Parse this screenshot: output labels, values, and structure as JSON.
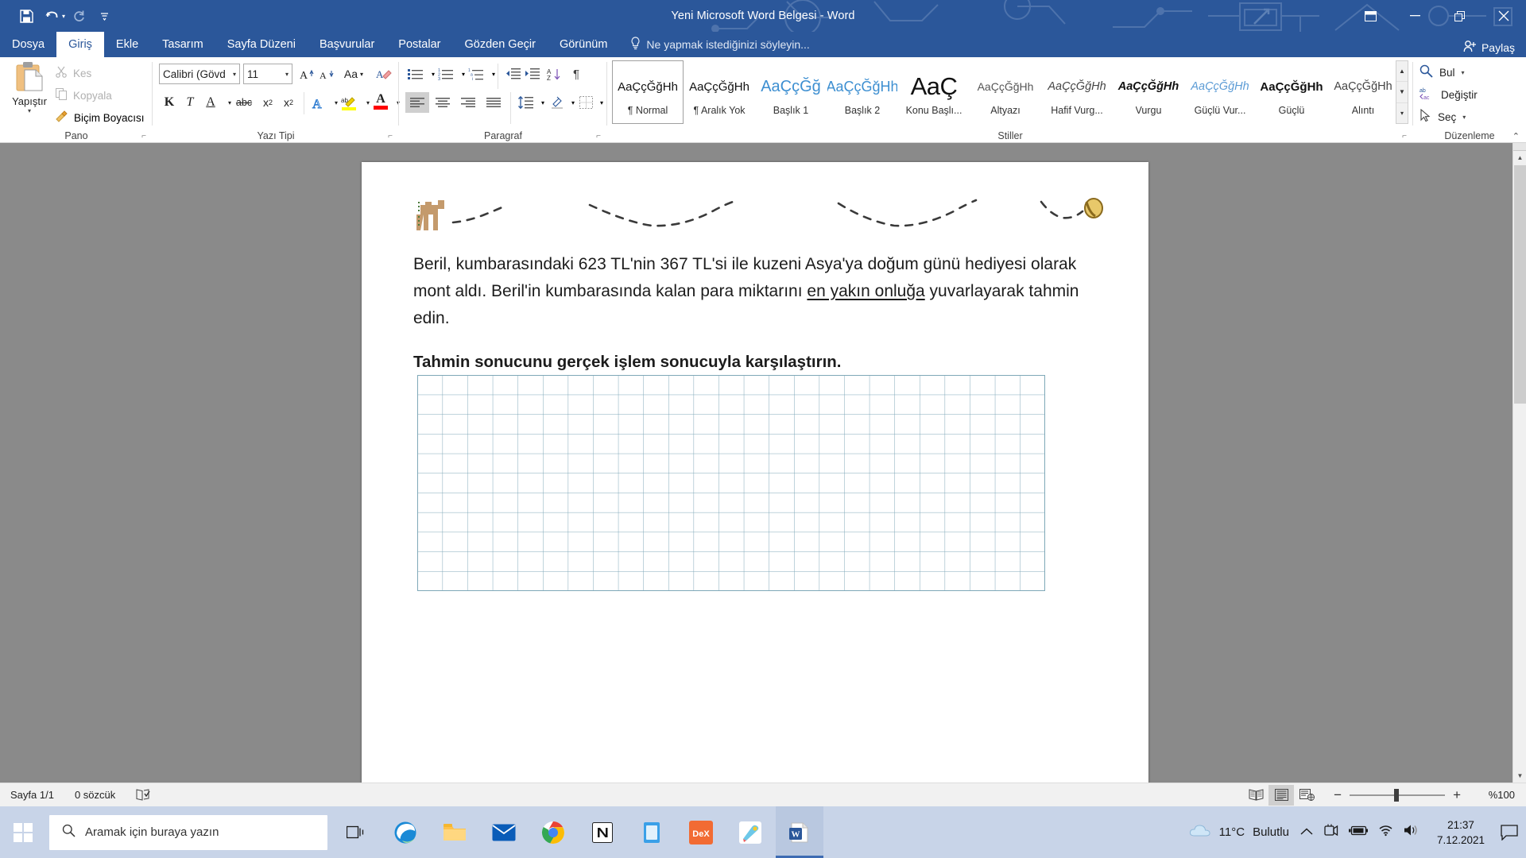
{
  "titlebar": {
    "title": "Yeni Microsoft Word Belgesi - Word",
    "qat": [
      {
        "name": "save-icon",
        "label": "Kaydet"
      },
      {
        "name": "undo-icon",
        "label": "Geri Al"
      },
      {
        "name": "redo-icon",
        "label": "Yinele"
      },
      {
        "name": "customize-qat-icon",
        "label": "Hızlı Erişim Araç Çubuğunu Özelleştir"
      }
    ],
    "window_controls": [
      {
        "name": "ribbon-display-options-icon",
        "label": "Şerit Görüntüleme Seçenekleri"
      },
      {
        "name": "minimize-icon",
        "label": "Simge Durumuna Küçült"
      },
      {
        "name": "restore-icon",
        "label": "Geri Yükle"
      },
      {
        "name": "close-icon",
        "label": "Kapat"
      }
    ],
    "accent": "#2b579a"
  },
  "tabs": [
    {
      "label": "Dosya",
      "active": false
    },
    {
      "label": "Giriş",
      "active": true
    },
    {
      "label": "Ekle",
      "active": false
    },
    {
      "label": "Tasarım",
      "active": false
    },
    {
      "label": "Sayfa Düzeni",
      "active": false
    },
    {
      "label": "Başvurular",
      "active": false
    },
    {
      "label": "Postalar",
      "active": false
    },
    {
      "label": "Gözden Geçir",
      "active": false
    },
    {
      "label": "Görünüm",
      "active": false
    }
  ],
  "tellme": {
    "placeholder": "Ne yapmak istediğinizi söyleyin...",
    "icon": "lightbulb-icon"
  },
  "share": {
    "label": "Paylaş",
    "icon": "share-person-icon"
  },
  "ribbon": {
    "groups": [
      {
        "name": "Pano"
      },
      {
        "name": "Yazı Tipi"
      },
      {
        "name": "Paragraf"
      },
      {
        "name": "Stiller"
      },
      {
        "name": "Düzenleme"
      }
    ],
    "clipboard": {
      "paste_label": "Yapıştır",
      "items": [
        {
          "label": "Kes",
          "icon": "scissors-icon",
          "disabled": true
        },
        {
          "label": "Kopyala",
          "icon": "copy-icon",
          "disabled": true
        },
        {
          "label": "Biçim Boyacısı",
          "icon": "format-painter-icon",
          "disabled": false
        }
      ]
    },
    "font": {
      "font_name": "Calibri (Gövd",
      "font_size": "11",
      "buttons": [
        {
          "name": "grow-font-icon",
          "label": "A"
        },
        {
          "name": "shrink-font-icon",
          "label": "A"
        },
        {
          "name": "change-case-icon",
          "label": "Aa"
        },
        {
          "name": "clear-formatting-icon",
          "label": "Biçimlendirmeyi Temizle"
        },
        {
          "name": "bold-icon",
          "label": "K"
        },
        {
          "name": "italic-icon",
          "label": "T"
        },
        {
          "name": "underline-icon",
          "label": "A"
        },
        {
          "name": "strikethrough-icon",
          "label": "abc"
        },
        {
          "name": "subscript-icon",
          "label": "x₂"
        },
        {
          "name": "superscript-icon",
          "label": "x²"
        },
        {
          "name": "text-effects-icon",
          "label": "A"
        },
        {
          "name": "text-highlight-color-icon",
          "label": "ab"
        },
        {
          "name": "font-color-icon",
          "label": "A"
        }
      ]
    },
    "paragraph": {
      "buttons": [
        {
          "name": "bullets-icon"
        },
        {
          "name": "numbering-icon"
        },
        {
          "name": "multilevel-list-icon"
        },
        {
          "name": "decrease-indent-icon"
        },
        {
          "name": "increase-indent-icon"
        },
        {
          "name": "sort-icon"
        },
        {
          "name": "show-formatting-marks-icon"
        },
        {
          "name": "align-left-icon"
        },
        {
          "name": "align-center-icon"
        },
        {
          "name": "align-right-icon"
        },
        {
          "name": "justify-icon"
        },
        {
          "name": "line-spacing-icon"
        },
        {
          "name": "shading-icon"
        },
        {
          "name": "borders-icon"
        }
      ]
    },
    "styles": [
      {
        "preview": "AaÇçĞğHh",
        "name": "¶ Normal",
        "selected": true,
        "style": "normal"
      },
      {
        "preview": "AaÇçĞğHh",
        "name": "¶ Aralık Yok",
        "selected": false,
        "style": "normal"
      },
      {
        "preview": "AaÇçĞğ",
        "name": "Başlık 1",
        "selected": false,
        "style": "heading1"
      },
      {
        "preview": "AaÇçĞğHh",
        "name": "Başlık 2",
        "selected": false,
        "style": "heading2"
      },
      {
        "preview": "AaÇ",
        "name": "Konu Başlı...",
        "selected": false,
        "style": "title"
      },
      {
        "preview": "AaÇçĞğHh",
        "name": "Altyazı",
        "selected": false,
        "style": "subtitle"
      },
      {
        "preview": "AaÇçĞğHh",
        "name": "Hafif Vurg...",
        "selected": false,
        "style": "subtle-emph"
      },
      {
        "preview": "AaÇçĞğHh",
        "name": "Vurgu",
        "selected": false,
        "style": "emph"
      },
      {
        "preview": "AaÇçĞğHh",
        "name": "Güçlü Vur...",
        "selected": false,
        "style": "intense-emph"
      },
      {
        "preview": "AaÇçĞğHh",
        "name": "Güçlü",
        "selected": false,
        "style": "strong"
      },
      {
        "preview": "AaÇçĞğHh",
        "name": "Alıntı",
        "selected": false,
        "style": "quote"
      }
    ],
    "editing": [
      {
        "label": "Bul",
        "icon": "search-icon",
        "caret": true
      },
      {
        "label": "Değiştir",
        "icon": "replace-icon",
        "caret": false
      },
      {
        "label": "Seç",
        "icon": "select-pointer-icon",
        "caret": true
      }
    ],
    "collapse_label": "Şeridi Daralt"
  },
  "document": {
    "paragraph1_a": "Beril, kumbarasındaki 623 TL'nin 367 TL'si ile kuzeni Asya'ya doğum günü hediyesi olarak mont aldı. Beril'in kumbarasında kalan para miktarını ",
    "paragraph1_underlined": "en yakın onluğa",
    "paragraph1_b": " yuvarlayarak tahmin edin.",
    "paragraph2": "Tahmin sonucunu gerçek işlem sonucuyla karşılaştırın.",
    "decoration": "camel-walking-dashed-path-image",
    "grid": "square-grid-worksheet-area"
  },
  "statusbar": {
    "page": "Sayfa 1/1",
    "words": "0 sözcük",
    "proofing_icon": "proofing-errors-icon",
    "views": [
      {
        "name": "read-mode-icon",
        "selected": false
      },
      {
        "name": "print-layout-icon",
        "selected": true
      },
      {
        "name": "web-layout-icon",
        "selected": false
      }
    ],
    "zoom_out": "−",
    "zoom_in": "+",
    "zoom_level": "%100"
  },
  "taskbar": {
    "search_placeholder": "Aramak için buraya yazın",
    "start_icon": "windows-start-icon",
    "search_icon": "search-icon",
    "taskview_icon": "task-view-icon",
    "apps": [
      {
        "name": "edge-icon",
        "label": "Microsoft Edge",
        "active": false
      },
      {
        "name": "file-explorer-icon",
        "label": "Dosya Gezgini",
        "active": false
      },
      {
        "name": "mail-icon",
        "label": "Posta",
        "active": false
      },
      {
        "name": "chrome-icon",
        "label": "Google Chrome",
        "active": false
      },
      {
        "name": "notion-icon",
        "label": "Notion",
        "active": false
      },
      {
        "name": "store-icon",
        "label": "Microsoft Store",
        "active": false
      },
      {
        "name": "dex-icon",
        "label": "DeX",
        "active": false
      },
      {
        "name": "paint3d-icon",
        "label": "Paint 3D",
        "active": false
      },
      {
        "name": "word-icon",
        "label": "Word",
        "active": true
      }
    ],
    "weather": {
      "temp": "11°C",
      "condition": "Bulutlu",
      "icon": "cloud-icon"
    },
    "tray": [
      {
        "name": "show-hidden-icons-icon"
      },
      {
        "name": "samsung-flow-icon"
      },
      {
        "name": "battery-icon"
      },
      {
        "name": "wifi-icon"
      },
      {
        "name": "volume-icon"
      }
    ],
    "clock": {
      "time": "21:37",
      "date": "7.12.2021"
    },
    "notifications_icon": "action-center-icon"
  }
}
